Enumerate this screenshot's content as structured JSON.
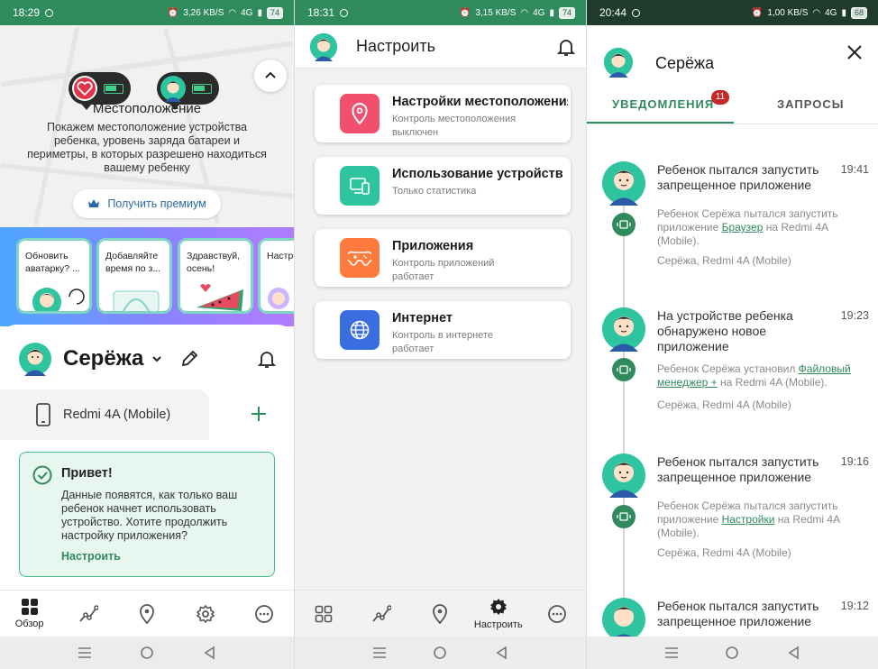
{
  "colors": {
    "brand_green": "#2f8a5c",
    "status_dark": "#1f3b2b",
    "accent_blue": "#2b6aa8",
    "badge_red": "#c62828"
  },
  "panel1": {
    "status": {
      "time": "18:29",
      "net": "3,26",
      "net_unit": "KB/S",
      "signal": "4G",
      "battery": "74"
    },
    "map": {
      "title": "Местоположение",
      "description": "Покажем местоположение устройства ребенка, уровень заряда батареи и периметры, в которых разрешено находиться вашему ребенку",
      "premium_label": "Получить премиум"
    },
    "stories": [
      "Обновить аватарку? ...",
      "Добавляйте время по з...",
      "Здравствуй, осень!",
      "Настр уже ра"
    ],
    "child_name": "Серёжа",
    "device_name": "Redmi 4A (Mobile)",
    "hello": {
      "title": "Привет!",
      "text": "Данные появятся, как только ваш ребенок начнет использовать устройство. Хотите продолжить настройку приложения?",
      "link": "Настроить"
    },
    "tabs": {
      "overview": "Обзор"
    }
  },
  "panel2": {
    "status": {
      "time": "18:31",
      "net": "3,15",
      "net_unit": "KB/S",
      "signal": "4G",
      "battery": "74"
    },
    "title": "Настроить",
    "cards": [
      {
        "title": "Настройки местоположения",
        "subtitle": "Контроль местоположения выключен",
        "icon": "location-pin-icon",
        "color": "#f0506e"
      },
      {
        "title": "Использование устройств",
        "subtitle": "Только статистика",
        "icon": "devices-icon",
        "color": "#2ec4a0"
      },
      {
        "title": "Приложения",
        "subtitle": "Контроль приложений работает",
        "icon": "gamepad-icon",
        "color": "#ff7a3d"
      },
      {
        "title": "Интернет",
        "subtitle": "Контроль в интернете работает",
        "icon": "globe-icon",
        "color": "#3a6de0"
      }
    ],
    "tabs": {
      "settings": "Настроить"
    }
  },
  "panel3": {
    "status": {
      "time": "20:44",
      "net": "1,00",
      "net_unit": "KB/S",
      "signal": "4G",
      "battery": "68"
    },
    "child_name": "Серёжа",
    "tab_notifications": "УВЕДОМЛЕНИЯ",
    "tab_requests": "ЗАПРОСЫ",
    "badge_count": "11",
    "notifications": [
      {
        "title": "Ребенок пытался запустить запрещенное приложение",
        "time": "19:41",
        "body_before": "Ребенок Серёжа пытался запустить приложение ",
        "app": "Браузер",
        "body_after": " на Redmi 4A (Mobile).",
        "device": "Серёжа, Redmi 4A (Mobile)"
      },
      {
        "title": "На устройстве ребенка обнаружено новое приложение",
        "time": "19:23",
        "body_before": "Ребенок Серёжа установил ",
        "app": "Файловый менеджер +",
        "body_after": " на Redmi 4A (Mobile).",
        "device": "Серёжа, Redmi 4A (Mobile)"
      },
      {
        "title": "Ребенок пытался запустить запрещенное приложение",
        "time": "19:16",
        "body_before": "Ребенок Серёжа пытался запустить приложение ",
        "app": "Настройки",
        "body_after": " на Redmi 4A (Mobile).",
        "device": "Серёжа, Redmi 4A (Mobile)"
      },
      {
        "title": "Ребенок пытался запустить запрещенное приложение",
        "time": "19:12"
      }
    ]
  }
}
